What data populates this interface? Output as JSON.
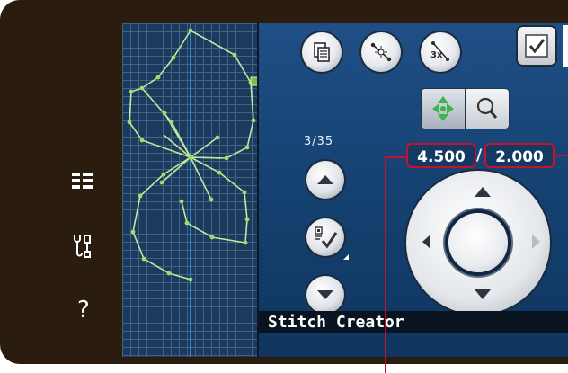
{
  "screen": {
    "title": "Stitch Creator",
    "stitch_counter": "3/35",
    "position_value": "4.500",
    "separator": "/",
    "width_value": "2.000"
  },
  "toolbar": {
    "buttons": [
      "duplicate-icon",
      "insert-point-icon",
      "triple-stitch-icon",
      "confirm-check-icon"
    ]
  },
  "view_toggle": [
    "move-arrows-icon",
    "zoom-magnifier-icon"
  ],
  "side_nav": [
    "menu-list-icon",
    "settings-tools-icon",
    "help-icon"
  ],
  "help_label": "?",
  "stepper": [
    "arrow-up-icon",
    "select-check-icon",
    "arrow-down-icon"
  ],
  "colors": {
    "accent_red": "#c8102e",
    "stitch_green": "#a8d86a",
    "panel_blue": "#1f4f86",
    "grid_blue": "#1b3a5c",
    "frame_brown": "#2a1d10"
  }
}
